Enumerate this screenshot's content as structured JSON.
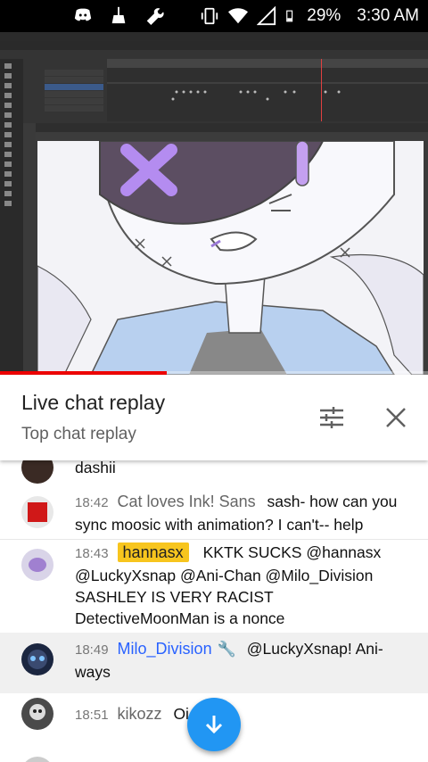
{
  "status_bar": {
    "battery": "29%",
    "time": "3:30 AM"
  },
  "video": {
    "progress_fraction": 0.39
  },
  "chat_header": {
    "title": "Live chat replay",
    "subtitle": "Top chat replay",
    "filter_icon": "tune-icon",
    "close_icon": "close-icon"
  },
  "messages": [
    {
      "time": "",
      "author": "",
      "text": "dashii",
      "type": "partial"
    },
    {
      "time": "18:42",
      "author": "Cat loves Ink! Sans",
      "text": "sash- how can you sync moosic with animation? I can't-- help",
      "type": "normal"
    },
    {
      "time": "18:43",
      "author": "hannasx",
      "text": "KKTK SUCKS @hannasx @LuckyXsnap @Ani-Chan @Milo_Division SASHLEY IS VERY RACIST DetectiveMoonMan is a nonce",
      "type": "owner"
    },
    {
      "time": "18:49",
      "author": "Milo_Division",
      "text": "@LuckyXsnap! Ani-ways",
      "type": "moderator"
    },
    {
      "time": "18:51",
      "author": "kikozz",
      "text": "Oi",
      "type": "normal"
    },
    {
      "time": "",
      "author": "",
      "text": "",
      "type": "cut"
    }
  ],
  "fab": {
    "icon": "arrow-down-icon"
  },
  "colors": {
    "accent_blue": "#2196f3",
    "owner_badge": "#f7c51e",
    "moderator": "#2962ff",
    "progress": "#ff0000"
  }
}
